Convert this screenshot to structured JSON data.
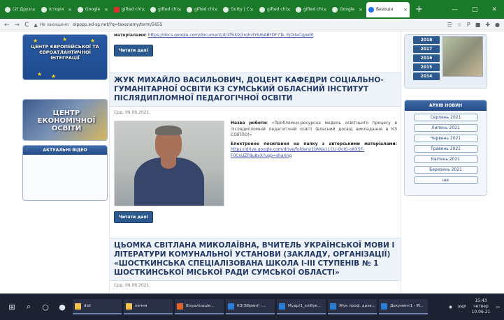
{
  "browser": {
    "tabs": [
      {
        "label": "(2) Друзі",
        "icon": "facebook-favicon"
      },
      {
        "label": "Історія",
        "icon": "history-icon"
      },
      {
        "label": "Google",
        "icon": "google-favicon"
      },
      {
        "label": "gifted chi",
        "icon": "youtube-favicon"
      },
      {
        "label": "gifted chi",
        "icon": "site-favicon"
      },
      {
        "label": "gifted chi",
        "icon": "site-favicon"
      },
      {
        "label": "Gutty | C",
        "icon": "site-favicon"
      },
      {
        "label": "gifted chi",
        "icon": "site-favicon"
      },
      {
        "label": "gifted chi",
        "icon": "site-favicon"
      },
      {
        "label": "Google",
        "icon": "google-favicon"
      },
      {
        "label": "Безоцін",
        "icon": "site-favicon"
      }
    ],
    "new_tab": "+",
    "window_controls": [
      "—",
      "□",
      "✕"
    ],
    "nav": {
      "back": "←",
      "forward": "→",
      "reload": "C"
    },
    "security_warning": "Не захищено",
    "url": "oipopp.ed-sp.net/?q=taxonomy/term/5655",
    "extensions": [
      "☰",
      "☆",
      "P",
      "■",
      "✚",
      "●"
    ]
  },
  "left_sidebar": {
    "eu_banner_text": "ЦЕНТР ЄВРОПЕЙСЬКОЇ ТА ЄВРОАТЛАНТИЧНОЇ ІНТЕГРАЦІЇ",
    "econ_banner_text": "ЦЕНТР ЕКОНОМІЧНОЇ ОСВІТИ",
    "video_widget_title": "АКТУАЛЬНІ ВІДЕО"
  },
  "main": {
    "top_snippet_label": "матеріалами:",
    "top_snippet_link": "https://docs.google.com/document/d/1fSik9j3rgln3YiU6ABYOF7Te_EjOiIaCg/edit",
    "read_more": "Читати далі",
    "article1": {
      "title": "ЖУК МИХАЙЛО ВАСИЛЬОВИЧ, ДОЦЕНТ КАФЕДРИ СОЦІАЛЬНО-ГУМАНІТАРНОЇ ОСВІТИ КЗ СУМСЬКИЙ ОБЛАСНИЙ ІНСТИТУТ ПІСЛЯДИПЛОМНОЇ ПЕДАГОГІЧНОЇ ОСВІТИ",
      "date": "Срд, 09.06.2021",
      "work_label": "Назва роботи:",
      "work_text": "«Проблемно-ресурсна модель освітнього процесу в післядипломній педагогічній освіті (власний досвід викладання в КЗ СОІППО)»",
      "link_label": "Електронне посилання на папку з авторськими матеріалами:",
      "link_url": "https://drive.google.com/drive/folders/1bNVa11CU-OcIG-o8X5F-F0CvUZF8u8vX?usp=sharing"
    },
    "article2": {
      "title": "ЦЬОМКА СВІТЛАНА МИКОЛАЇВНА, ВЧИТЕЛЬ УКРАЇНСЬКОЇ МОВИ І ЛІТЕРАТУРИ КОМУНАЛЬНОЇ УСТАНОВИ (ЗАКЛАДУ, ОРГАНІЗАЦІЇ) «ШОСТКИНСЬКА СПЕЦІАЛІЗОВАНА ШКОЛА І-ІІІ СТУПЕНІВ № 1 ШОСТКИНСЬКОЇ МІСЬКОЇ РАДИ СУМСЬКОЇ ОБЛАСТІ»",
      "date": "Срд, 09.06.2021"
    }
  },
  "right_sidebar": {
    "years": [
      "2018",
      "2017",
      "2016",
      "2015",
      "2014"
    ],
    "archive_title": "АРХІВ НОВИН",
    "months": [
      "Серпень 2021",
      "Липень 2021",
      "Червень 2021",
      "Травень 2021",
      "Квітень 2021",
      "Березень 2021",
      "ще"
    ]
  },
  "taskbar": {
    "tasks": [
      {
        "label": "dist",
        "color": "#f2c14e"
      },
      {
        "label": "печня",
        "color": "#f2c14e"
      },
      {
        "label": "Візуалізація...",
        "color": "#e0632c"
      },
      {
        "label": "КЗ(Зібрані) -...",
        "color": "#2b7cd3"
      },
      {
        "label": "Мудр(1_хлібує...",
        "color": "#2b7cd3"
      },
      {
        "label": "Жук проф. диза...",
        "color": "#2b7cd3"
      },
      {
        "label": "Документ1 - W...",
        "color": "#2b7cd3"
      }
    ],
    "tray_lang": "УКР",
    "time": "15:43",
    "weekday": "четвер",
    "date": "10.06.21"
  }
}
